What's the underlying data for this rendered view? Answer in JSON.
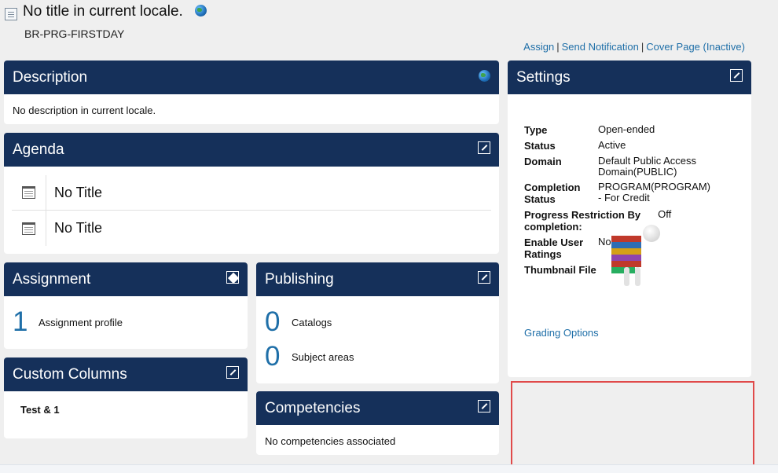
{
  "page": {
    "title": "No title in current locale.",
    "code": "BR-PRG-FIRSTDAY",
    "links": [
      "Assign",
      "Send Notification",
      "Cover Page (Inactive)"
    ]
  },
  "description": {
    "header": "Description",
    "text": "No description in current locale."
  },
  "agenda": {
    "header": "Agenda",
    "items": [
      "No Title",
      "No Title"
    ]
  },
  "assignment": {
    "header": "Assignment",
    "count": "1",
    "label": "Assignment profile"
  },
  "publishing": {
    "header": "Publishing",
    "catalogs_count": "0",
    "catalogs_label": "Catalogs",
    "subjects_count": "0",
    "subjects_label": "Subject areas"
  },
  "custom_columns": {
    "header": "Custom Columns",
    "value": "Test & 1"
  },
  "competencies": {
    "header": "Competencies",
    "text": "No competencies associated"
  },
  "settings": {
    "header": "Settings",
    "type_label": "Type",
    "type_value": "Open-ended",
    "status_label": "Status",
    "status_value": "Active",
    "domain_label": "Domain",
    "domain_value": "Default Public Access Domain(PUBLIC)",
    "completion_label": "Completion Status",
    "completion_value": "PROGRAM(PROGRAM) - For Credit",
    "progress_label": "Progress Restriction By completion:",
    "progress_value": "Off",
    "ratings_label": "Enable User Ratings",
    "ratings_value": "No",
    "thumbnail_label": "Thumbnail File",
    "grading_link": "Grading Options"
  },
  "colors": {
    "header_bg": "#15305a",
    "link": "#1f6fa8",
    "highlight": "#e04a4a"
  }
}
